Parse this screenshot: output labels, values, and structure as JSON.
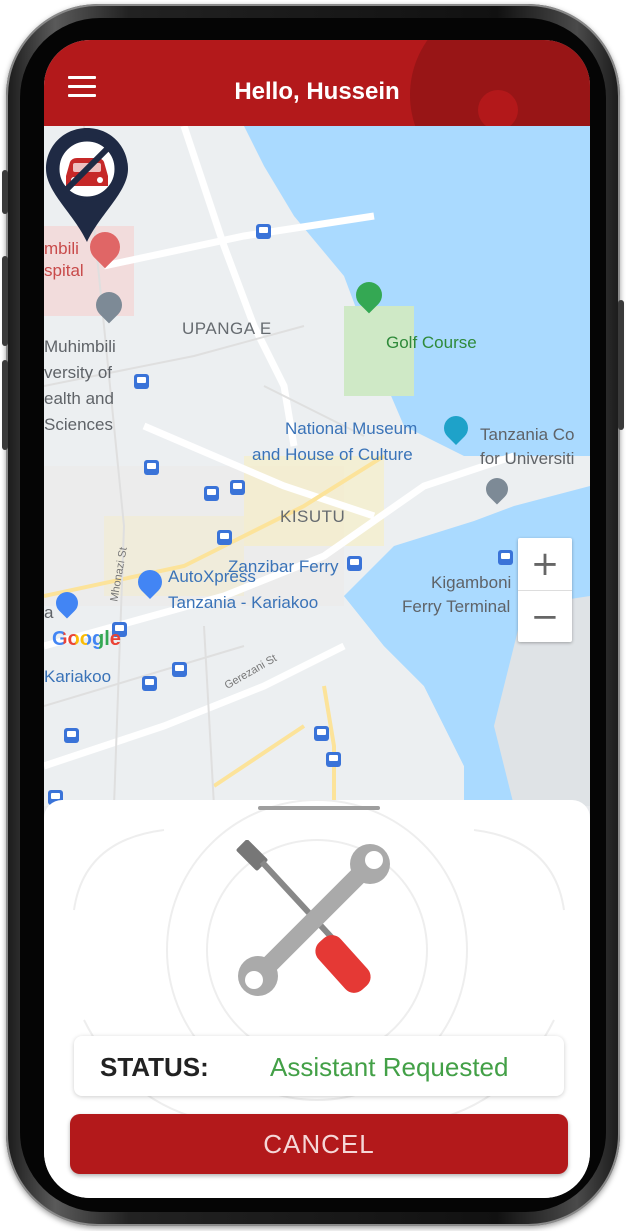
{
  "header": {
    "greeting": "Hello, Hussein",
    "menu_icon": "hamburger-menu-icon",
    "color": "#b3191b"
  },
  "map": {
    "labels": {
      "hospital_1": "mbili",
      "hospital_2": "spital",
      "muhimbili": "Muhimbili",
      "university_1": "versity of",
      "university_2": "ealth and",
      "university_3": "Sciences",
      "upanga": "UPANGA E",
      "golf": "Golf Course",
      "museum_1": "National Museum",
      "museum_2": "and House of Culture",
      "tanzania_1": "Tanzania Co",
      "tanzania_2": "for Universiti",
      "kisutu": "KISUTU",
      "ferry": "Zanzibar Ferry",
      "autoxpress_1": "AutoXpress",
      "autoxpress_2": "Tanzania - Kariakoo",
      "kigamboni_1": "Kigamboni",
      "kigamboni_2": "Ferry Terminal",
      "kariakoo": "Kariakoo",
      "street_1": "Mhonazi St",
      "street_2": "Gerezani St",
      "edge_a": "a"
    },
    "google": "Google",
    "zoom_in": "+",
    "zoom_out": "−",
    "pin_icon": "no-car-location-pin-icon"
  },
  "sheet": {
    "tools_icon": "wrench-screwdriver-icon",
    "status_label": "STATUS:",
    "status_value": "Assistant Requested",
    "status_color": "#43a047",
    "cancel_label": "CANCEL"
  }
}
